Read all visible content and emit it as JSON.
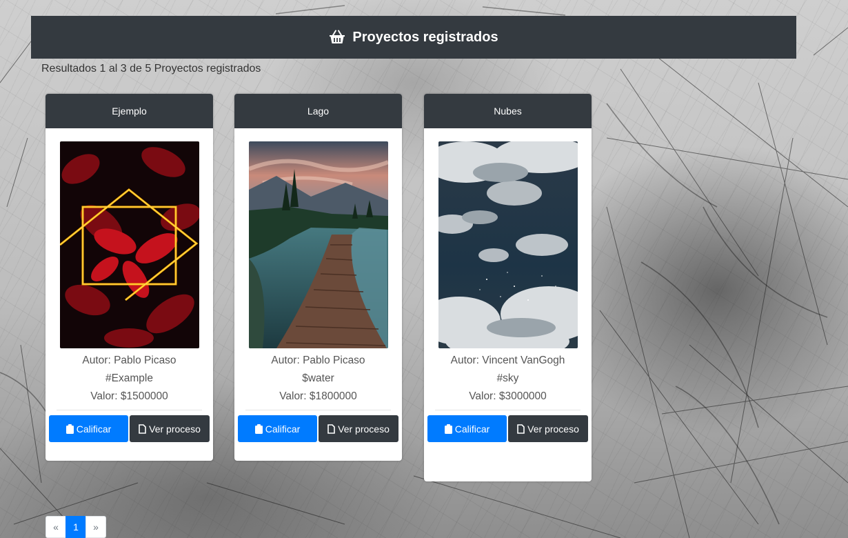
{
  "header": {
    "title": "Proyectos registrados",
    "icon": "shopping-basket-icon"
  },
  "results_text": "Resultados 1 al 3 de 5 Proyectos registrados",
  "cards": [
    {
      "title": "Ejemplo",
      "author": "Autor: Pablo Picaso",
      "tag": "#Example",
      "value": "Valor: $1500000",
      "image": "neon-leaves-image",
      "rate_label": "Calificar",
      "process_label": "Ver proceso"
    },
    {
      "title": "Lago",
      "author": "Autor: Pablo Picaso",
      "tag": "$water",
      "value": "Valor: $1800000",
      "image": "lake-boardwalk-image",
      "rate_label": "Calificar",
      "process_label": "Ver proceso"
    },
    {
      "title": "Nubes",
      "author": "Autor: Vincent VanGogh",
      "tag": "#sky",
      "value": "Valor: $3000000",
      "image": "night-clouds-image",
      "rate_label": "Calificar",
      "process_label": "Ver proceso"
    }
  ],
  "pagination": {
    "prev": "«",
    "current": "1",
    "next": "»"
  },
  "colors": {
    "header_bg": "#343a40",
    "primary": "#007bff",
    "dark": "#343a40"
  }
}
